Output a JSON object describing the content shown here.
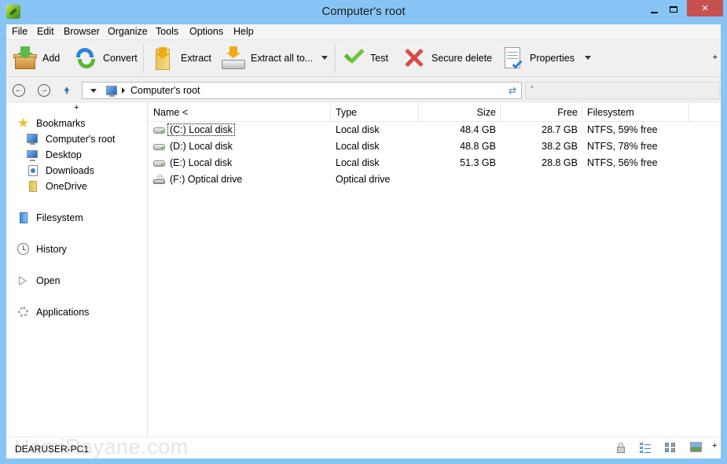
{
  "window": {
    "title": "Computer's root",
    "controls": {
      "minimize": "minimize",
      "maximize": "maximize",
      "close": "×"
    }
  },
  "menu": [
    "File",
    "Edit",
    "Browser",
    "Organize",
    "Tools",
    "Options",
    "Help"
  ],
  "toolbar": {
    "add": "Add",
    "convert": "Convert",
    "extract": "Extract",
    "extract_all": "Extract all to...",
    "test": "Test",
    "secure_delete": "Secure delete",
    "properties": "Properties",
    "more": "+"
  },
  "address": {
    "path": "Computer's root",
    "filter_placeholder": "*"
  },
  "sidebar": {
    "add": "+",
    "bookmarks_label": "Bookmarks",
    "bookmarks": [
      "Computer's root",
      "Desktop",
      "Downloads",
      "OneDrive"
    ],
    "sections": [
      "Filesystem",
      "History",
      "Open",
      "Applications"
    ]
  },
  "filelist": {
    "columns": [
      "Name <",
      "Type",
      "Size",
      "Free",
      "Filesystem"
    ],
    "rows": [
      {
        "name": "(C:) Local disk",
        "type": "Local disk",
        "size": "48.4 GB",
        "free": "28.7 GB",
        "fs": "NTFS, 59% free",
        "icon": "hard-drive"
      },
      {
        "name": "(D:) Local disk",
        "type": "Local disk",
        "size": "48.8 GB",
        "free": "38.2 GB",
        "fs": "NTFS, 78% free",
        "icon": "hard-drive"
      },
      {
        "name": "(E:) Local disk",
        "type": "Local disk",
        "size": "51.3 GB",
        "free": "28.8 GB",
        "fs": "NTFS, 56% free",
        "icon": "hard-drive"
      },
      {
        "name": "(F:) Optical drive",
        "type": "Optical drive",
        "size": "",
        "free": "",
        "fs": "",
        "icon": "optical-drive"
      }
    ]
  },
  "status": {
    "computer_name": "DEARUSER-PC1",
    "watermark": "HamiRayane.com",
    "more": "+"
  }
}
